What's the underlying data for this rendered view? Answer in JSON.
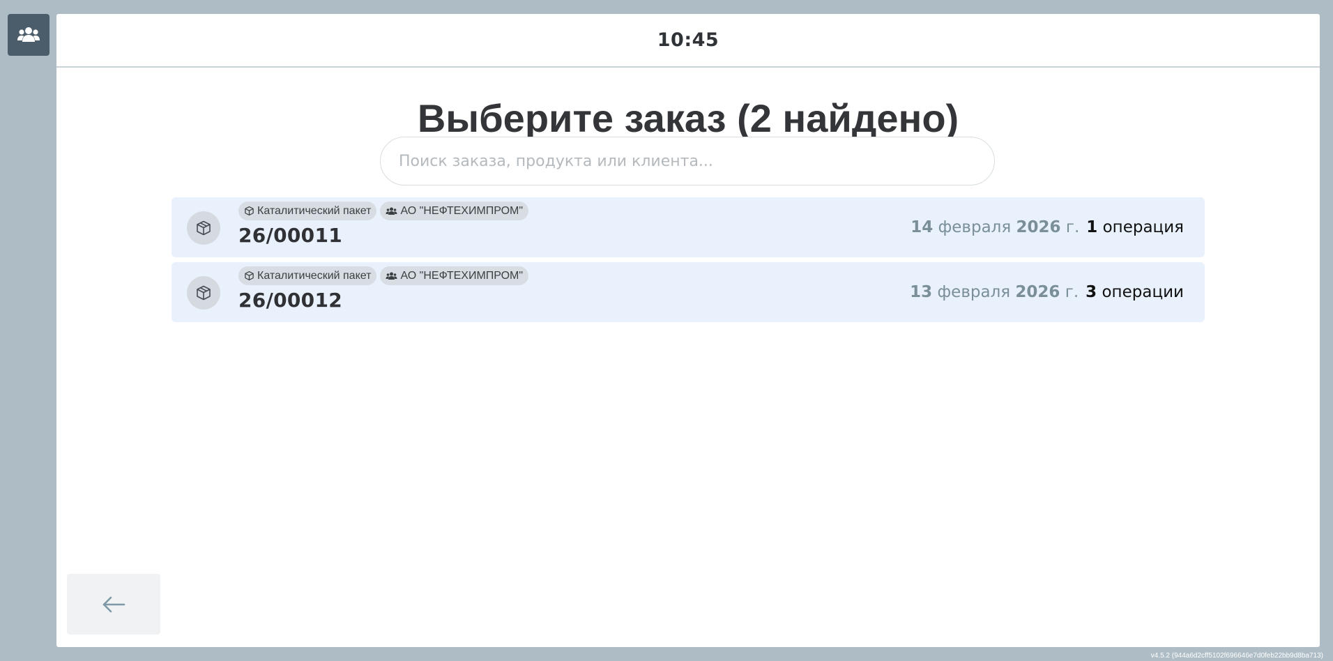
{
  "header": {
    "clock": "10:45"
  },
  "sidebar": {
    "users_button_icon": "users-icon"
  },
  "main": {
    "title": "Выберите заказ (2 найдено)",
    "search": {
      "placeholder": "Поиск заказа, продукта или клиента...",
      "value": ""
    },
    "orders": [
      {
        "icon": "box-icon",
        "product_tag": "Каталитический пакет",
        "client_tag": "АО \"НЕФТЕХИМПРОМ\"",
        "number": "26/00011",
        "date_day": "14",
        "date_month": "февраля",
        "date_year": "2026",
        "date_suffix": "г.",
        "ops_count": "1",
        "ops_label": "операция"
      },
      {
        "icon": "box-icon",
        "product_tag": "Каталитический пакет",
        "client_tag": "АО \"НЕФТЕХИМПРОМ\"",
        "number": "26/00012",
        "date_day": "13",
        "date_month": "февраля",
        "date_year": "2026",
        "date_suffix": "г.",
        "ops_count": "3",
        "ops_label": "операции"
      }
    ]
  },
  "footer": {
    "back_icon": "arrow-left-icon",
    "version": "v4.5.2 (944a6d2cff5102f696646e7d0feb22bb9d8ba713)"
  },
  "colors": {
    "background": "#aebdc5",
    "sidebar_button": "#4b5d6a",
    "order_row": "#e9f1fd",
    "date_text": "#7a8f98",
    "tag_bg": "#d7dde3"
  }
}
